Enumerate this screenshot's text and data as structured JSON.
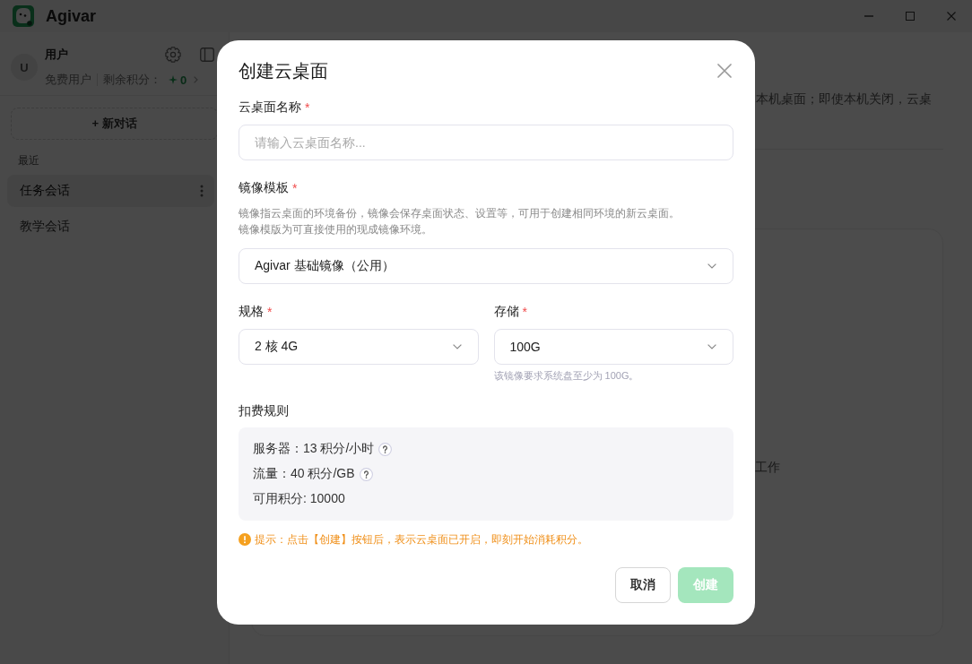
{
  "window": {
    "app_name": "Agivar"
  },
  "sidebar": {
    "user": {
      "avatar_initial": "U",
      "name": "用户",
      "plan": "免费用户",
      "points_label": "剩余积分：",
      "points": "0"
    },
    "new_chat_label": "+ 新对话",
    "section_title": "最近",
    "items": [
      {
        "label": "任务会话",
        "selected": true
      },
      {
        "label": "教学会话",
        "selected": false
      }
    ]
  },
  "main": {
    "description": "本机桌面；即使本机关闭，云桌",
    "card_text": "工作"
  },
  "dialog": {
    "title": "创建云桌面",
    "rows": [
      {
        "fields": [
          {
            "kind": "text",
            "label": "云桌面名称",
            "required_mark": "*",
            "placeholder": "请输入云桌面名称..."
          }
        ]
      },
      {
        "fields": [
          {
            "kind": "select",
            "label": "镜像模板",
            "required_mark": "*",
            "description_lines": [
              "镜像指云桌面的环境备份，镜像会保存桌面状态、设置等，可用于创建相同环境的新云桌面。",
              "镜像模版为可直接使用的现成镜像环境。"
            ],
            "value": "Agivar 基础镜像（公用）"
          }
        ]
      },
      {
        "fields": [
          {
            "kind": "select",
            "label": "规格",
            "required_mark": "*",
            "value": "2 核 4G"
          },
          {
            "kind": "select",
            "label": "存储",
            "required_mark": "*",
            "value": "100G",
            "hint": "该镜像要求系统盘至少为 100G。"
          }
        ]
      }
    ],
    "billing": {
      "title": "扣费规则",
      "lines": [
        {
          "text": "服务器：13 积分/小时",
          "help": true
        },
        {
          "text": "流量：40 积分/GB",
          "help": true
        },
        {
          "text": "可用积分: 10000",
          "help": false
        }
      ]
    },
    "notice": "提示：点击【创建】按钮后，表示云桌面已开启，即刻开始消耗积分。",
    "buttons": [
      {
        "label": "取消",
        "kind": "secondary",
        "disabled": false
      },
      {
        "label": "创建",
        "kind": "primary",
        "disabled": true
      }
    ]
  }
}
